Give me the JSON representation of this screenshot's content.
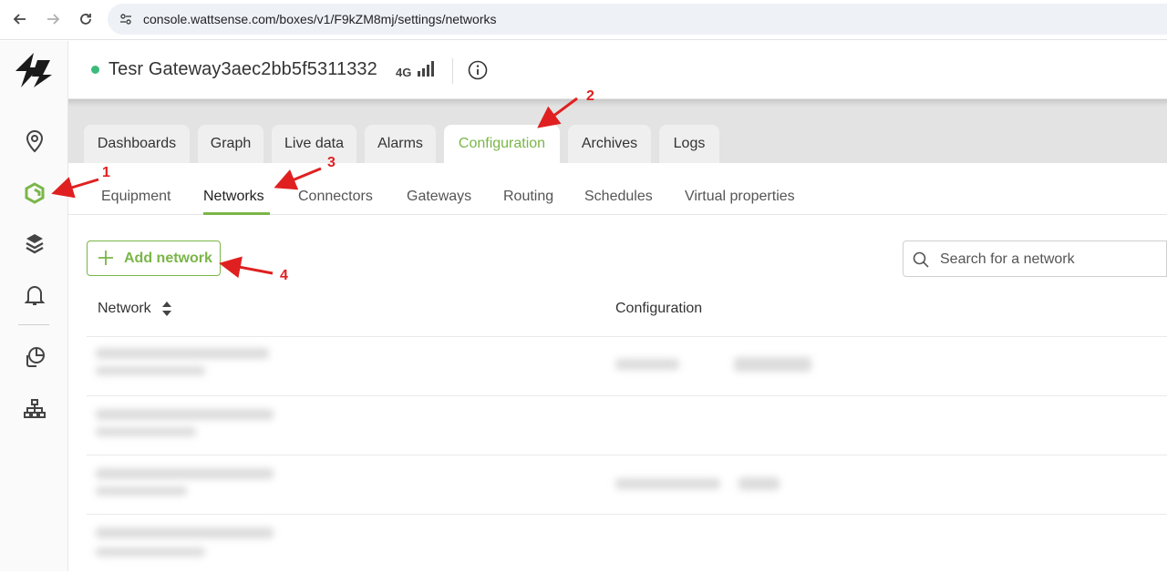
{
  "browser": {
    "url": "console.wattsense.com/boxes/v1/F9kZM8mj/settings/networks"
  },
  "sidebar": {
    "items": [
      {
        "icon": "location-pin-icon"
      },
      {
        "icon": "box-devices-icon",
        "active": true
      },
      {
        "icon": "layers-icon"
      },
      {
        "icon": "bell-icon"
      },
      {
        "icon": "documents-icon"
      },
      {
        "icon": "org-chart-icon"
      }
    ]
  },
  "header": {
    "title": "Tesr Gateway3aec2bb5f5311332",
    "network_type": "4G",
    "status_color": "#3cba7b"
  },
  "tabs": [
    {
      "label": "Dashboards"
    },
    {
      "label": "Graph"
    },
    {
      "label": "Live data"
    },
    {
      "label": "Alarms"
    },
    {
      "label": "Configuration",
      "active": true
    },
    {
      "label": "Archives"
    },
    {
      "label": "Logs"
    }
  ],
  "subtabs": [
    {
      "label": "Equipment"
    },
    {
      "label": "Networks",
      "active": true
    },
    {
      "label": "Connectors"
    },
    {
      "label": "Gateways"
    },
    {
      "label": "Routing"
    },
    {
      "label": "Schedules"
    },
    {
      "label": "Virtual properties"
    }
  ],
  "toolbar": {
    "add_label": "Add network",
    "search_placeholder": "Search for a network"
  },
  "table": {
    "columns": [
      "Network",
      "Configuration"
    ]
  },
  "annotations": [
    "1",
    "2",
    "3",
    "4"
  ],
  "colors": {
    "accent": "#7ab648",
    "annotation": "#e02020"
  }
}
